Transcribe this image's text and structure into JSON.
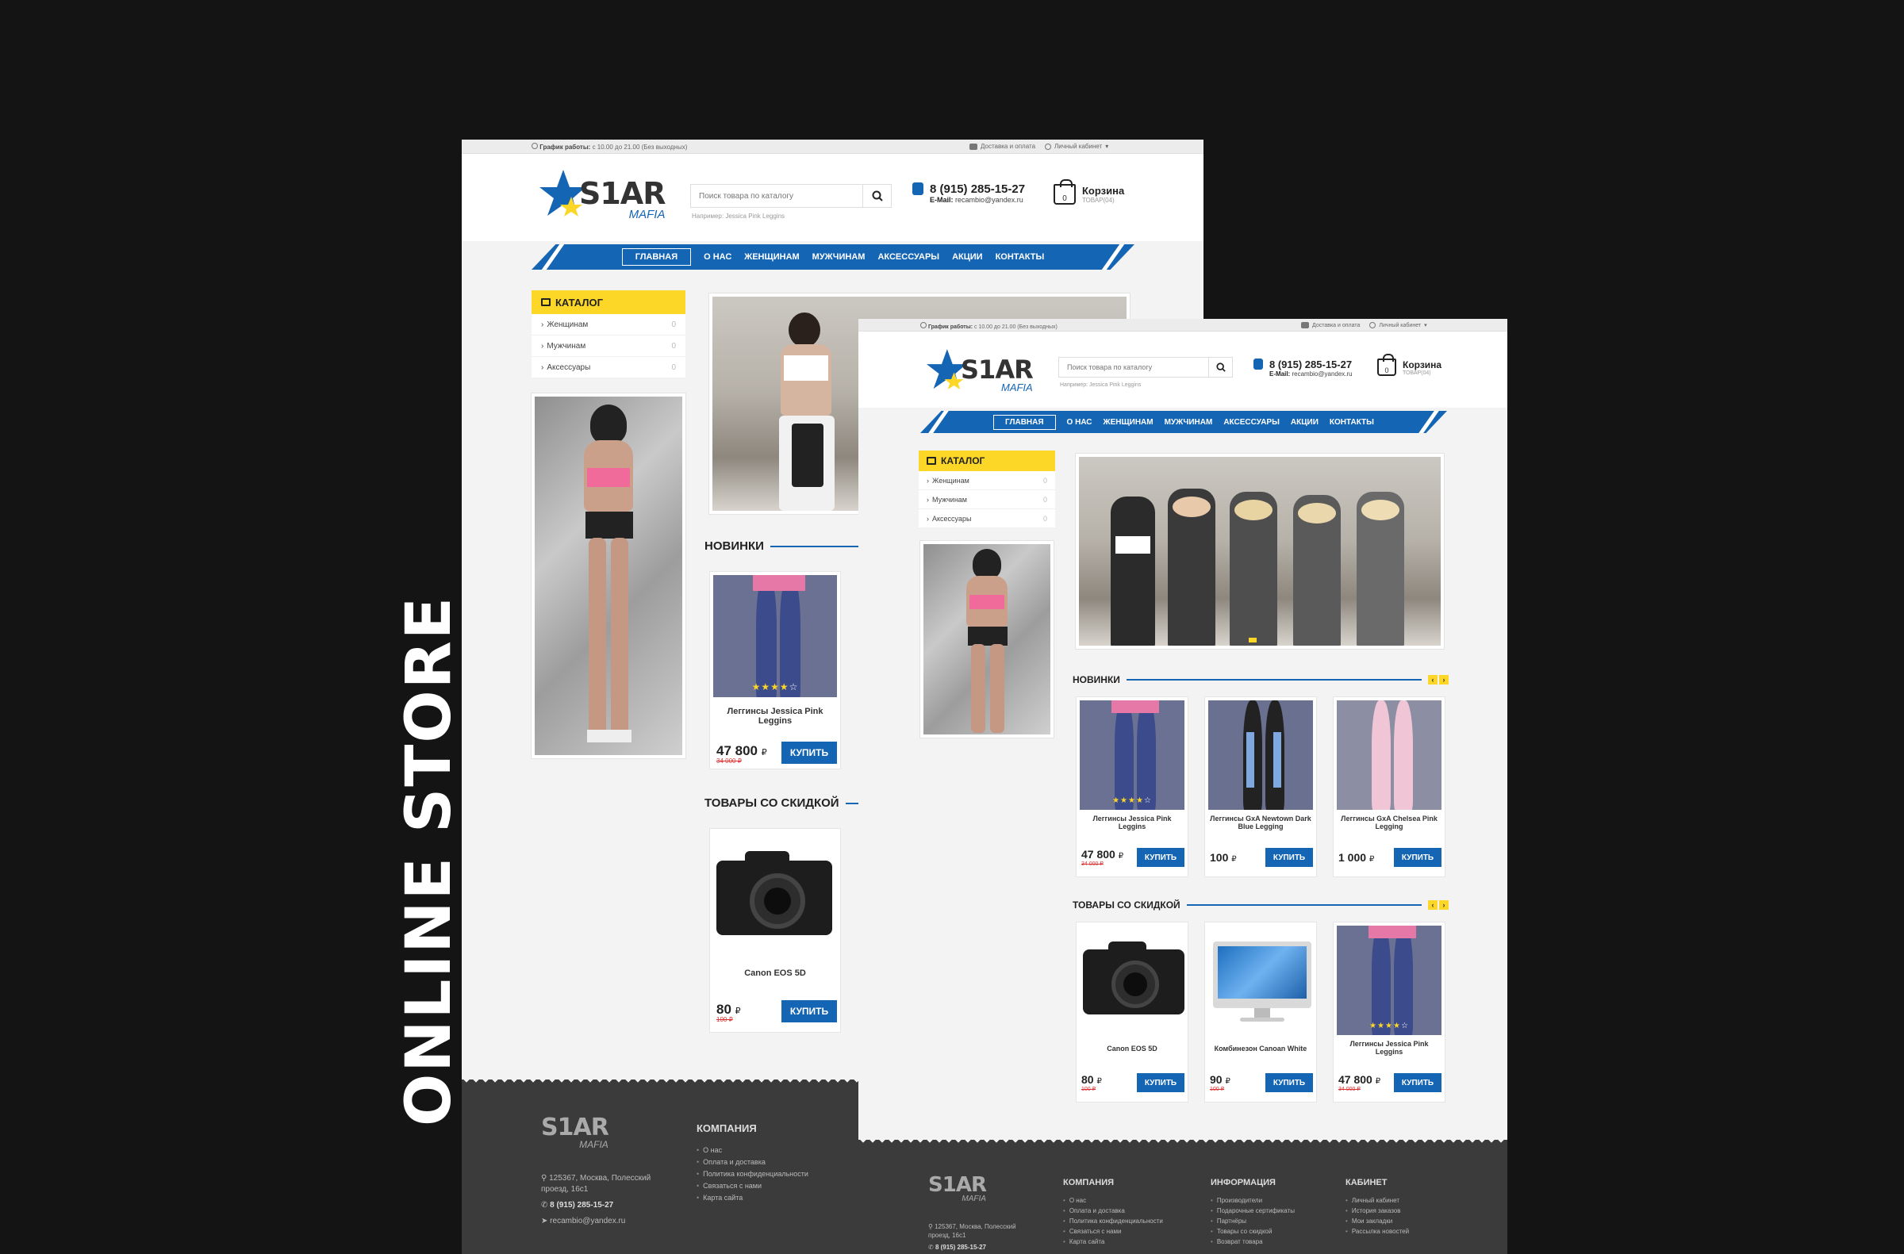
{
  "side_title": "ONLINE STORE",
  "colors": {
    "accent": "#1565b5",
    "yellow": "#fcd728",
    "footer": "#3b3b3b",
    "page_bg": "#141414"
  },
  "site": {
    "schedule_label": "График работы:",
    "schedule_value": "с 10.00 до 21.00 (Без выходных)",
    "delivery_link": "Доставка и оплата",
    "account_link": "Личный кабинет",
    "logo_main": "S1AR",
    "logo_sub": "MAFIA",
    "search_placeholder": "Поиск товара по каталогу",
    "search_hint": "Например: Jessica Pink Leggins",
    "phone": "8 (915) 285-15-27",
    "email_label": "E-Mail:",
    "email": "recambio@yandex.ru",
    "cart_title": "Корзина",
    "cart_sub": "ТОВАР(04)",
    "cart_count": "0",
    "nav": [
      "ГЛАВНАЯ",
      "О НАС",
      "ЖЕНЩИНАМ",
      "МУЖЧИНАМ",
      "АКСЕССУАРЫ",
      "АКЦИИ",
      "КОНТАКТЫ"
    ],
    "catalog_title": "КАТАЛОГ",
    "catalog_items": [
      {
        "label": "Женщинам",
        "count": "0"
      },
      {
        "label": "Мужчинам",
        "count": "0"
      },
      {
        "label": "Аксессуары",
        "count": "0"
      }
    ],
    "new_title": "НОВИНКИ",
    "sale_title": "ТОВАРЫ СО СКИДКОЙ",
    "buy_label": "КУПИТЬ",
    "currency": "₽",
    "new_products": [
      {
        "name": "Леггинсы Jessica Pink Leggins",
        "price": "47 800",
        "old": "34 000 ₽",
        "rating": 4
      },
      {
        "name": "Леггинсы GxA Newtown Dark Blue Legging",
        "price": "100",
        "old": "",
        "rating": 0
      },
      {
        "name": "Леггинсы GxA Chelsea Pink Legging",
        "price": "1 000",
        "old": "",
        "rating": 0
      }
    ],
    "sale_products": [
      {
        "name": "Canon EOS 5D",
        "price": "80",
        "old": "100 ₽",
        "rating": 0
      },
      {
        "name": "Комбинезон Canoan White",
        "price": "90",
        "old": "100 ₽",
        "rating": 0
      },
      {
        "name": "Леггинсы Jessica Pink Leggins",
        "price": "47 800",
        "old": "34 000 ₽",
        "rating": 4
      }
    ],
    "footer": {
      "address": "125367, Москва, Полесский проезд, 16с1",
      "phone": "8 (915) 285-15-27",
      "email": "recambio@yandex.ru",
      "company_title": "КОМПАНИЯ",
      "company_items": [
        "О нас",
        "Оплата и доставка",
        "Политика конфиденциальности",
        "Связаться с нами",
        "Карта сайта"
      ],
      "info_title": "ИНФОРМАЦИЯ",
      "info_items": [
        "Производители",
        "Подарочные сертификаты",
        "Партнёры",
        "Товары со скидкой",
        "Возврат товара"
      ],
      "cabinet_title": "КАБИНЕТ",
      "cabinet_items": [
        "Личный кабинет",
        "История заказов",
        "Мои закладки",
        "Рассылка новостей"
      ]
    }
  }
}
